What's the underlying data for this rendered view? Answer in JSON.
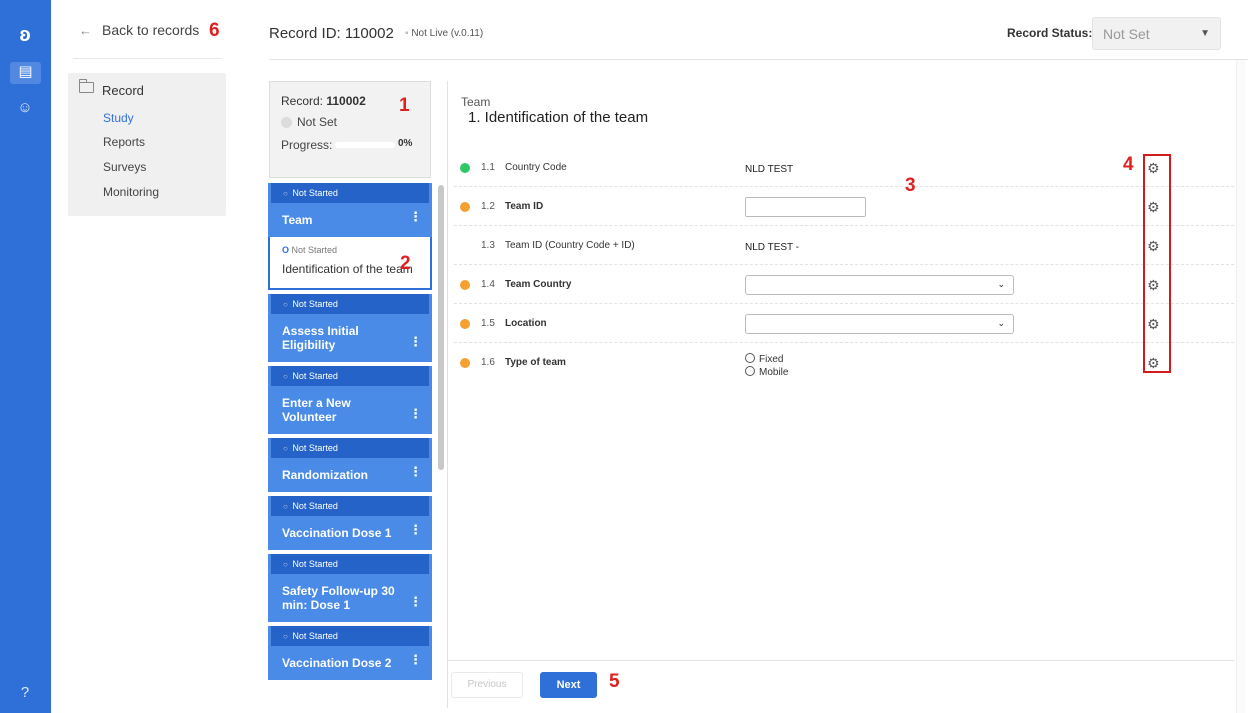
{
  "rail": {
    "logo": "ʚ",
    "icons": [
      "records-icon",
      "user-icon",
      "help-icon"
    ]
  },
  "nav": {
    "back_label": "Back to records",
    "record_label": "Record",
    "items": [
      "Study",
      "Reports",
      "Surveys",
      "Monitoring"
    ]
  },
  "header": {
    "record_id": "Record ID: 110002",
    "live": "◦ Not Live (v.0.11)",
    "record_status_label": "Record Status:",
    "record_status_value": "Not Set"
  },
  "summary": {
    "record_prefix": "Record: ",
    "record_id": "110002",
    "status": "Not Set",
    "progress_label": "Progress:",
    "progress_pct": "0%",
    "progress": 0
  },
  "steps": [
    {
      "status": "Not Started",
      "title": "Team",
      "sub": {
        "status": "Not Started",
        "title": "Identification of the team"
      }
    },
    {
      "status": "Not Started",
      "title": "Assess Initial Eligibility"
    },
    {
      "status": "Not Started",
      "title": "Enter a New Volunteer"
    },
    {
      "status": "Not Started",
      "title": "Randomization"
    },
    {
      "status": "Not Started",
      "title": "Vaccination Dose 1"
    },
    {
      "status": "Not Started",
      "title": "Safety Follow-up 30 min: Dose 1"
    },
    {
      "status": "Not Started",
      "title": "Vaccination Dose 2"
    }
  ],
  "form": {
    "section": "Team",
    "title": "1. Identification of the team",
    "rows": [
      {
        "num": "1.1",
        "label": "Country Code",
        "value": "NLD TEST",
        "status_color": "#2ec866"
      },
      {
        "num": "1.2",
        "label": "Team ID",
        "value": "",
        "status_color": "#f5a031"
      },
      {
        "num": "1.3",
        "label": "Team ID (Country Code + ID)",
        "value": "NLD TEST -",
        "status_color": ""
      },
      {
        "num": "1.4",
        "label": "Team Country",
        "value": "",
        "status_color": "#f5a031"
      },
      {
        "num": "1.5",
        "label": "Location",
        "value": "",
        "status_color": "#f5a031"
      },
      {
        "num": "1.6",
        "label": "Type of team",
        "value": "",
        "status_color": "#f5a031",
        "options": [
          "Fixed",
          "Mobile"
        ]
      }
    ]
  },
  "buttons": {
    "previous": "Previous",
    "next": "Next"
  },
  "annotations": [
    "1",
    "2",
    "3",
    "4",
    "5",
    "6"
  ],
  "colors": {
    "brand": "#2f6fd8",
    "step_bg": "#4a8be8",
    "status_bg": "#2563c9",
    "annotation": "#e02020"
  }
}
